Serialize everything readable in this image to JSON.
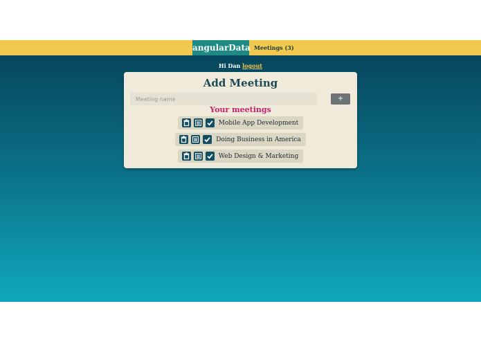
{
  "header": {
    "brand": "angularData",
    "nav_link": "Meetings (3)"
  },
  "greeting": {
    "text": "Hi Dan",
    "logout_label": "logout"
  },
  "card": {
    "title": "Add Meeting",
    "input_placeholder": "Meeting name",
    "add_button_label": "+",
    "section_heading": "Your meetings"
  },
  "meetings": [
    {
      "name": "Mobile App Development",
      "icons": [
        "trash-icon",
        "list-icon",
        "checkbox-icon"
      ]
    },
    {
      "name": "Doing Business in America",
      "icons": [
        "trash-icon",
        "list-icon",
        "checkbox-icon"
      ]
    },
    {
      "name": "Web Design & Marketing",
      "icons": [
        "trash-icon",
        "list-icon",
        "checkbox-icon"
      ]
    }
  ],
  "colors": {
    "header_bar": "#f1c94e",
    "brand_bg": "#1f8a84",
    "card_bg": "#efeada",
    "title": "#1b4a56",
    "section_heading": "#c8216c",
    "icon_bg": "#134d63"
  }
}
